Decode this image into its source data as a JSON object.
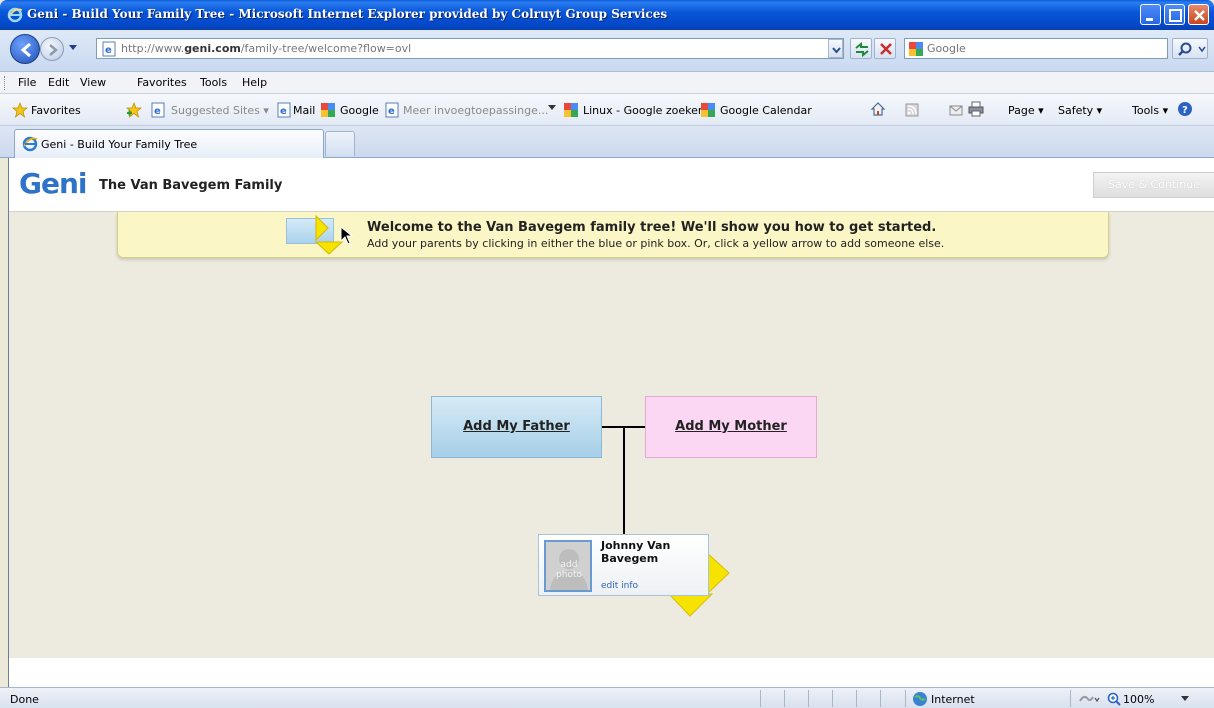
{
  "window": {
    "title": "Geni - Build Your Family Tree - Microsoft Internet Explorer provided by Colruyt Group Services"
  },
  "address_bar": {
    "url_prefix": "http://www.",
    "url_domain": "geni.com",
    "url_path": "/family-tree/welcome?flow=ovl",
    "search_placeholder": "Google"
  },
  "menu": {
    "items": [
      "File",
      "Edit",
      "View",
      "Favorites",
      "Tools",
      "Help"
    ]
  },
  "favorites_bar": {
    "favorites_label": "Favorites",
    "items": [
      "Suggested Sites ▾",
      "Mail",
      "Google",
      "Meer invoegtoepassinge...",
      "Linux - Google zoeken",
      "Google Calendar"
    ],
    "tools": [
      "Page ▾",
      "Safety ▾",
      "Tools ▾"
    ]
  },
  "tabs": {
    "active_label": "Geni - Build Your Family Tree"
  },
  "geni": {
    "logo": "Geni",
    "family_title": "The Van Bavegem Family",
    "save_button": "Save & Continue",
    "welcome_title": "Welcome to the Van Bavegem family tree! We'll show you how to get started.",
    "welcome_text": "Add your parents by clicking in either the blue or pink box. Or, click a yellow arrow to add someone else.",
    "add_father": "Add My Father",
    "add_mother": "Add My Mother",
    "person_name": "Johnny Van Bavegem",
    "photo_text": "add photo",
    "edit_info": "edit info"
  },
  "status_bar": {
    "status": "Done",
    "zone": "Internet",
    "zoom": "100%"
  }
}
